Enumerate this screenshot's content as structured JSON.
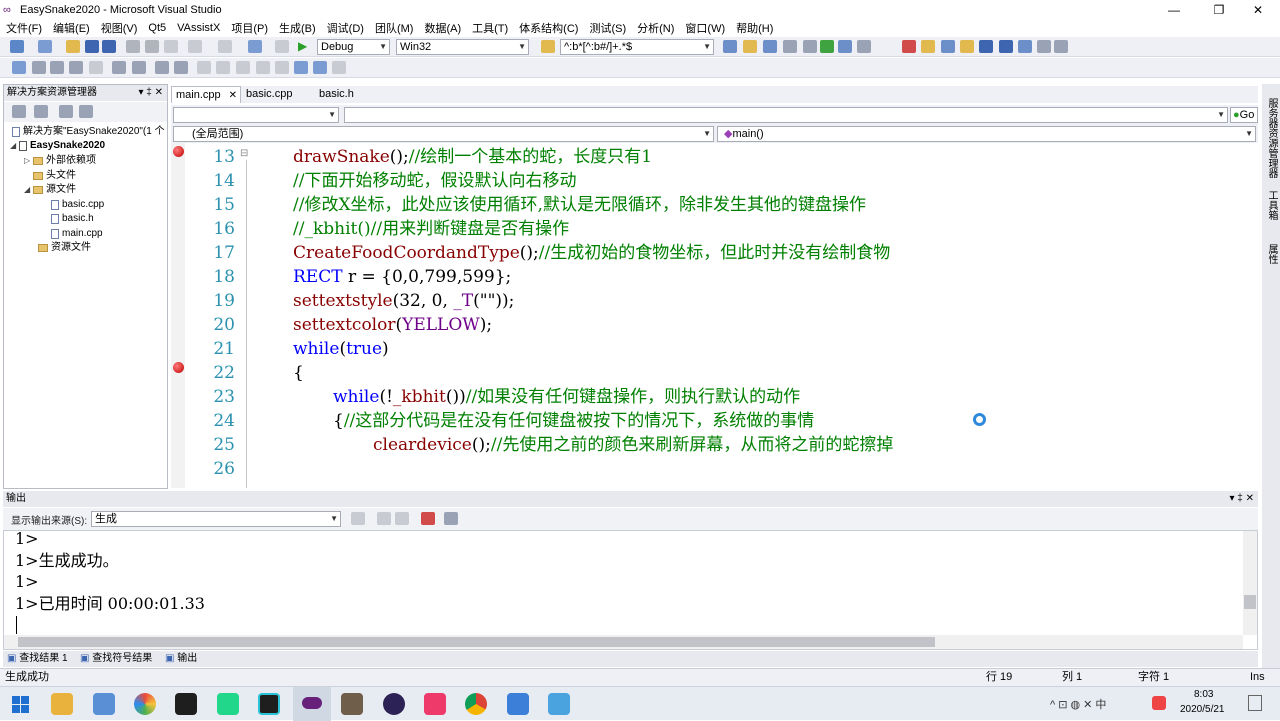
{
  "window": {
    "title": "EasySnake2020 - Microsoft Visual Studio",
    "minimize": "—",
    "maximize": "❐",
    "close": "✕"
  },
  "menu": [
    "文件(F)",
    "编辑(E)",
    "视图(V)",
    "Qt5",
    "VAssistX",
    "项目(P)",
    "生成(B)",
    "调试(D)",
    "团队(M)",
    "数据(A)",
    "工具(T)",
    "体系结构(C)",
    "测试(S)",
    "分析(N)",
    "窗口(W)",
    "帮助(H)"
  ],
  "toolbar": {
    "config": "Debug",
    "platform": "Win32",
    "find_regex": "^:b*[^:b#/]+.*$"
  },
  "solution_explorer": {
    "title": "解决方案资源管理器",
    "pin": "▾ ‡ ✕",
    "items": [
      {
        "label": "解决方案\"EasySnake2020\"(1 个",
        "kind": "solution"
      },
      {
        "label": "EasySnake2020",
        "kind": "project"
      },
      {
        "label": "外部依赖项",
        "kind": "folder"
      },
      {
        "label": "头文件",
        "kind": "folder"
      },
      {
        "label": "源文件",
        "kind": "folder"
      },
      {
        "label": "basic.cpp",
        "kind": "file"
      },
      {
        "label": "basic.h",
        "kind": "file"
      },
      {
        "label": "main.cpp",
        "kind": "file"
      },
      {
        "label": "资源文件",
        "kind": "folder"
      }
    ]
  },
  "editor": {
    "tabs": [
      {
        "label": "main.cpp",
        "close": "✕",
        "active": true
      },
      {
        "label": "basic.cpp",
        "active": false
      },
      {
        "label": "basic.h",
        "active": false
      }
    ],
    "go_button": "Go",
    "scope": "(全局范围)",
    "function": "main()",
    "lines": [
      {
        "n": "13",
        "bp": true,
        "fold": "⊟"
      },
      {
        "n": "14"
      },
      {
        "n": "15"
      },
      {
        "n": "16"
      },
      {
        "n": "17"
      },
      {
        "n": "18"
      },
      {
        "n": "19"
      },
      {
        "n": "20"
      },
      {
        "n": "21"
      },
      {
        "n": "22",
        "bp": true
      },
      {
        "n": "23"
      },
      {
        "n": "24"
      },
      {
        "n": "25"
      },
      {
        "n": "26"
      }
    ],
    "code": {
      "l13_fn": "drawSnake",
      "l13_rest": "();",
      "l13_cm": "//绘制一个基本的蛇，长度只有1",
      "l14": "//下面开始移动蛇，假设默认向右移动",
      "l15": "//修改X坐标，此处应该使用循环,默认是无限循环，除非发生其他的键盘操作",
      "l16": "//_kbhit()//用来判断键盘是否有操作",
      "l17_fn": "CreateFoodCoordandType",
      "l17_rest": "();",
      "l17_cm": "//生成初始的食物坐标，但此时并没有绘制食物",
      "l18_kw": "RECT",
      "l18_rest": " r = {0,0,799,599};",
      "l19_fn": "settextstyle",
      "l19_a": "(32, 0, ",
      "l19_mc": "_T",
      "l19_b": "(\"\"));",
      "l20_fn": "settextcolor",
      "l20_a": "(",
      "l20_mc": "YELLOW",
      "l20_b": ");",
      "l21_kw": "while",
      "l21_a": "(",
      "l21_kw2": "true",
      "l21_b": ")",
      "l22": "{",
      "l23_kw": "while",
      "l23_a": "(!",
      "l23_fn": "_kbhit",
      "l23_b": "())",
      "l23_cm": "//如果没有任何键盘操作，则执行默认的动作",
      "l24_a": "{",
      "l24_cm": "//这部分代码是在没有任何键盘被按下的情况下，系统做的事情",
      "l25_fn": "cleardevice",
      "l25_rest": "();",
      "l25_cm": "//先使用之前的颜色来刷新屏幕，从而将之前的蛇擦掉",
      "l26": ""
    }
  },
  "output": {
    "title": "输出",
    "source_label": "显示输出来源(S):",
    "source_value": "生成",
    "lines": [
      "1>",
      "1>生成成功。",
      "1>",
      "1>已用时间 00:00:01.33"
    ],
    "tabs": [
      "查找结果 1",
      "查找符号结果",
      "输出"
    ]
  },
  "right_strip": [
    "服务器资源管理器",
    "工具箱",
    "属性"
  ],
  "status": {
    "message": "生成成功",
    "row": "行 19",
    "col": "列 1",
    "char": "字符 1",
    "mode": "Ins"
  },
  "taskbar": {
    "time": "8:03",
    "date": "2020/5/21",
    "tray": "^ ⊡ ◍ ✕ 中"
  },
  "colors": {
    "keyword": "#0000ff",
    "comment": "#008000",
    "macro": "#6f008a",
    "line_number": "#2b91af",
    "breakpoint": "#c00000"
  }
}
